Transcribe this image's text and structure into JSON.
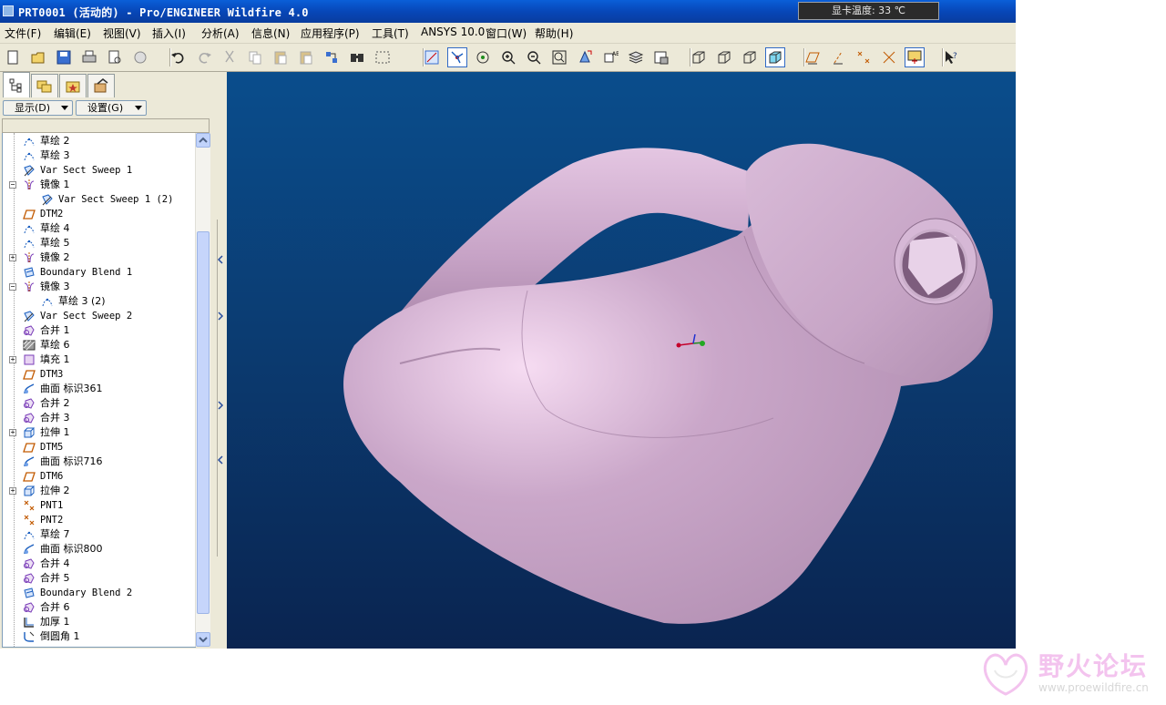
{
  "window": {
    "title": "PRT0001 (活动的) - Pro/ENGINEER Wildfire 4.0",
    "gpu_temp": "显卡温度: 33 ℃"
  },
  "menu": [
    {
      "label": "文件(F)"
    },
    {
      "label": "编辑(E)"
    },
    {
      "label": "视图(V)"
    },
    {
      "label": "插入(I)"
    },
    {
      "label": "分析(A)"
    },
    {
      "label": "信息(N)"
    },
    {
      "label": "应用程序(P)"
    },
    {
      "label": "工具(T)"
    },
    {
      "label": "ANSYS 10.0"
    },
    {
      "label": "窗口(W)"
    },
    {
      "label": "帮助(H)"
    }
  ],
  "toolbar": {
    "icons": [
      "new-icon",
      "open-icon",
      "save-icon",
      "print-icon",
      "print-preview-icon",
      "erase-icon",
      "undo-icon",
      "redo-icon",
      "cut-icon",
      "copy-icon",
      "paste-icon",
      "paste-special-icon",
      "regenerate-icon",
      "find-icon",
      "select-box-icon",
      "datum-display-icon",
      "spin-center-icon",
      "orient-icon",
      "zoom-in-icon",
      "zoom-out-icon",
      "refit-icon",
      "reorient-icon",
      "saved-views-icon",
      "layers-icon",
      "view-manager-icon",
      "wireframe-icon",
      "hidden-line-icon",
      "no-hidden-icon",
      "shading-icon",
      "datum-plane-display-icon",
      "datum-axis-display-icon",
      "datum-point-display-icon",
      "csys-display-icon",
      "spin-center-display-icon",
      "whats-this-icon"
    ]
  },
  "panel": {
    "show_label": "显示(D)",
    "settings_label": "设置(G)"
  },
  "tree": [
    {
      "label": "草绘 2",
      "icon": "sketch-icon",
      "indent": 0,
      "expand": ""
    },
    {
      "label": "草绘 3",
      "icon": "sketch-icon",
      "indent": 0,
      "expand": ""
    },
    {
      "label": "Var Sect Sweep 1",
      "icon": "sweep-icon",
      "indent": 0,
      "expand": ""
    },
    {
      "label": "镜像 1",
      "icon": "mirror-icon",
      "indent": 0,
      "expand": "−"
    },
    {
      "label": "Var Sect Sweep 1 (2)",
      "icon": "sweep-icon",
      "indent": 1,
      "expand": ""
    },
    {
      "label": "DTM2",
      "icon": "datum-plane-icon",
      "indent": 0,
      "expand": ""
    },
    {
      "label": "草绘 4",
      "icon": "sketch-icon",
      "indent": 0,
      "expand": ""
    },
    {
      "label": "草绘 5",
      "icon": "sketch-icon",
      "indent": 0,
      "expand": ""
    },
    {
      "label": "镜像 2",
      "icon": "mirror-icon",
      "indent": 0,
      "expand": "+"
    },
    {
      "label": "Boundary Blend 1",
      "icon": "boundary-blend-icon",
      "indent": 0,
      "expand": ""
    },
    {
      "label": "镜像 3",
      "icon": "mirror-icon",
      "indent": 0,
      "expand": "−"
    },
    {
      "label": "草绘 3 (2)",
      "icon": "sketch-icon",
      "indent": 1,
      "expand": ""
    },
    {
      "label": "Var Sect Sweep 2",
      "icon": "sweep-icon",
      "indent": 0,
      "expand": ""
    },
    {
      "label": "合并 1",
      "icon": "merge-icon",
      "indent": 0,
      "expand": ""
    },
    {
      "label": "草绘 6",
      "icon": "sketch-hatch-icon",
      "indent": 0,
      "expand": ""
    },
    {
      "label": "填充 1",
      "icon": "fill-icon",
      "indent": 0,
      "expand": "+"
    },
    {
      "label": "DTM3",
      "icon": "datum-plane-icon",
      "indent": 0,
      "expand": ""
    },
    {
      "label": "曲面 标识361",
      "icon": "surface-icon",
      "indent": 0,
      "expand": ""
    },
    {
      "label": "合并 2",
      "icon": "merge-icon",
      "indent": 0,
      "expand": ""
    },
    {
      "label": "合并 3",
      "icon": "merge-icon",
      "indent": 0,
      "expand": ""
    },
    {
      "label": "拉伸 1",
      "icon": "extrude-icon",
      "indent": 0,
      "expand": "+"
    },
    {
      "label": "DTM5",
      "icon": "datum-plane-icon",
      "indent": 0,
      "expand": ""
    },
    {
      "label": "曲面 标识716",
      "icon": "surface-icon",
      "indent": 0,
      "expand": ""
    },
    {
      "label": "DTM6",
      "icon": "datum-plane-icon",
      "indent": 0,
      "expand": ""
    },
    {
      "label": "拉伸 2",
      "icon": "extrude-icon",
      "indent": 0,
      "expand": "+"
    },
    {
      "label": "PNT1",
      "icon": "datum-point-icon",
      "indent": 0,
      "expand": ""
    },
    {
      "label": "PNT2",
      "icon": "datum-point-icon",
      "indent": 0,
      "expand": ""
    },
    {
      "label": "草绘 7",
      "icon": "sketch-icon",
      "indent": 0,
      "expand": ""
    },
    {
      "label": "曲面 标识800",
      "icon": "surface-icon",
      "indent": 0,
      "expand": ""
    },
    {
      "label": "合并 4",
      "icon": "merge-icon",
      "indent": 0,
      "expand": ""
    },
    {
      "label": "合并 5",
      "icon": "merge-icon",
      "indent": 0,
      "expand": ""
    },
    {
      "label": "Boundary Blend 2",
      "icon": "boundary-blend-icon",
      "indent": 0,
      "expand": ""
    },
    {
      "label": "合并 6",
      "icon": "merge-icon",
      "indent": 0,
      "expand": ""
    },
    {
      "label": "加厚 1",
      "icon": "thicken-icon",
      "indent": 0,
      "expand": ""
    },
    {
      "label": "倒圆角 1",
      "icon": "round-icon",
      "indent": 0,
      "expand": ""
    }
  ],
  "watermark": {
    "title": "野火论坛",
    "url": "www.proewildfire.cn"
  },
  "colors": {
    "titlebar": "#0a5fd8",
    "chrome": "#ece9d8",
    "model": "#c8a6c8",
    "viewport_top": "#0a4d8c",
    "viewport_bottom": "#0a2450"
  }
}
